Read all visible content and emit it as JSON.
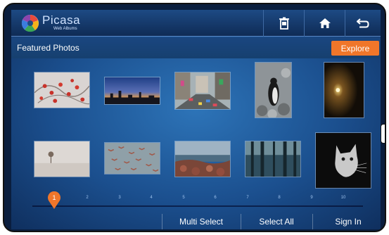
{
  "app": {
    "logo_text": "Picasa",
    "logo_subtext": "Web Albums",
    "icons": {
      "logo": "picasa-pinwheel-icon",
      "trash": "trash-icon",
      "home": "home-icon",
      "back": "back-icon"
    }
  },
  "header": {
    "section_title": "Featured Photos",
    "explore_label": "Explore"
  },
  "photos": [
    {
      "subject": "red berries on snowy branches"
    },
    {
      "subject": "city skyline at sunset"
    },
    {
      "subject": "busy city street"
    },
    {
      "subject": "penguin on rocks"
    },
    {
      "subject": "light at night"
    },
    {
      "subject": "lone tree in mist"
    },
    {
      "subject": "flock of birds"
    },
    {
      "subject": "rocky shoreline"
    },
    {
      "subject": "forest trees"
    },
    {
      "subject": "black and white cat"
    }
  ],
  "pager": {
    "current_page": "1",
    "pages": [
      "2",
      "3",
      "4",
      "5",
      "6",
      "7",
      "8",
      "9",
      "10"
    ]
  },
  "footer": {
    "multi_select": "Multi Select",
    "select_all": "Select All",
    "sign_in": "Sign In"
  },
  "colors": {
    "accent": "#f0762a",
    "background": "#1b4f8e"
  }
}
